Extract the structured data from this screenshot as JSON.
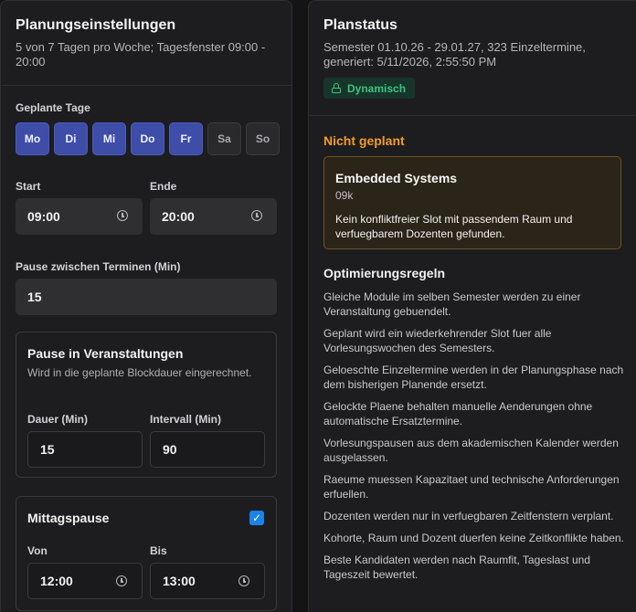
{
  "left": {
    "title": "Planungseinstellungen",
    "subtitle": "5 von 7 Tagen pro Woche; Tagesfenster 09:00 - 20:00",
    "days_label": "Geplante Tage",
    "days": [
      {
        "label": "Mo",
        "active": true
      },
      {
        "label": "Di",
        "active": true
      },
      {
        "label": "Mi",
        "active": true
      },
      {
        "label": "Do",
        "active": true
      },
      {
        "label": "Fr",
        "active": true
      },
      {
        "label": "Sa",
        "active": false
      },
      {
        "label": "So",
        "active": false
      }
    ],
    "start_label": "Start",
    "start_value": "09:00",
    "end_label": "Ende",
    "end_value": "20:00",
    "pause_label": "Pause zwischen Terminen (Min)",
    "pause_value": "15",
    "break_section": {
      "title": "Pause in Veranstaltungen",
      "subtitle": "Wird in die geplante Blockdauer eingerechnet.",
      "duration_label": "Dauer (Min)",
      "duration_value": "15",
      "interval_label": "Intervall (Min)",
      "interval_value": "90"
    },
    "lunch_section": {
      "title": "Mittagspause",
      "checked": true,
      "from_label": "Von",
      "from_value": "12:00",
      "to_label": "Bis",
      "to_value": "13:00"
    }
  },
  "right": {
    "title": "Planstatus",
    "subtitle": "Semester 01.10.26 - 29.01.27, 323 Einzeltermine, generiert: 5/11/2026, 2:55:50 PM",
    "badge": "Dynamisch",
    "not_planned_title": "Nicht geplant",
    "unplanned": {
      "name": "Embedded Systems",
      "code": "09k",
      "message": "Kein konfliktfreier Slot mit passendem Raum und verfuegbarem Dozenten gefunden."
    },
    "rules_title": "Optimierungsregeln",
    "rules": [
      "Gleiche Module im selben Semester werden zu einer Veranstaltung gebuendelt.",
      "Geplant wird ein wiederkehrender Slot fuer alle Vorlesungswochen des Semesters.",
      "Geloeschte Einzeltermine werden in der Planungsphase nach dem bisherigen Planende ersetzt.",
      "Gelockte Plaene behalten manuelle Aenderungen ohne automatische Ersatztermine.",
      "Vorlesungspausen aus dem akademischen Kalender werden ausgelassen.",
      "Raeume muessen Kapazitaet und technische Anforderungen erfuellen.",
      "Dozenten werden nur in verfuegbaren Zeitfenstern verplant.",
      "Kohorte, Raum und Dozent duerfen keine Zeitkonflikte haben.",
      "Beste Kandidaten werden nach Raumfit, Tageslast und Tageszeit bewertet."
    ]
  },
  "icons": {
    "time": "clock-icon",
    "check": "checkmark-icon",
    "badge": "unlock-icon"
  },
  "colors": {
    "active_day": "#3d4da8",
    "warning": "#f29c22",
    "success": "#3ec182",
    "checkbox": "#1b82e8"
  }
}
